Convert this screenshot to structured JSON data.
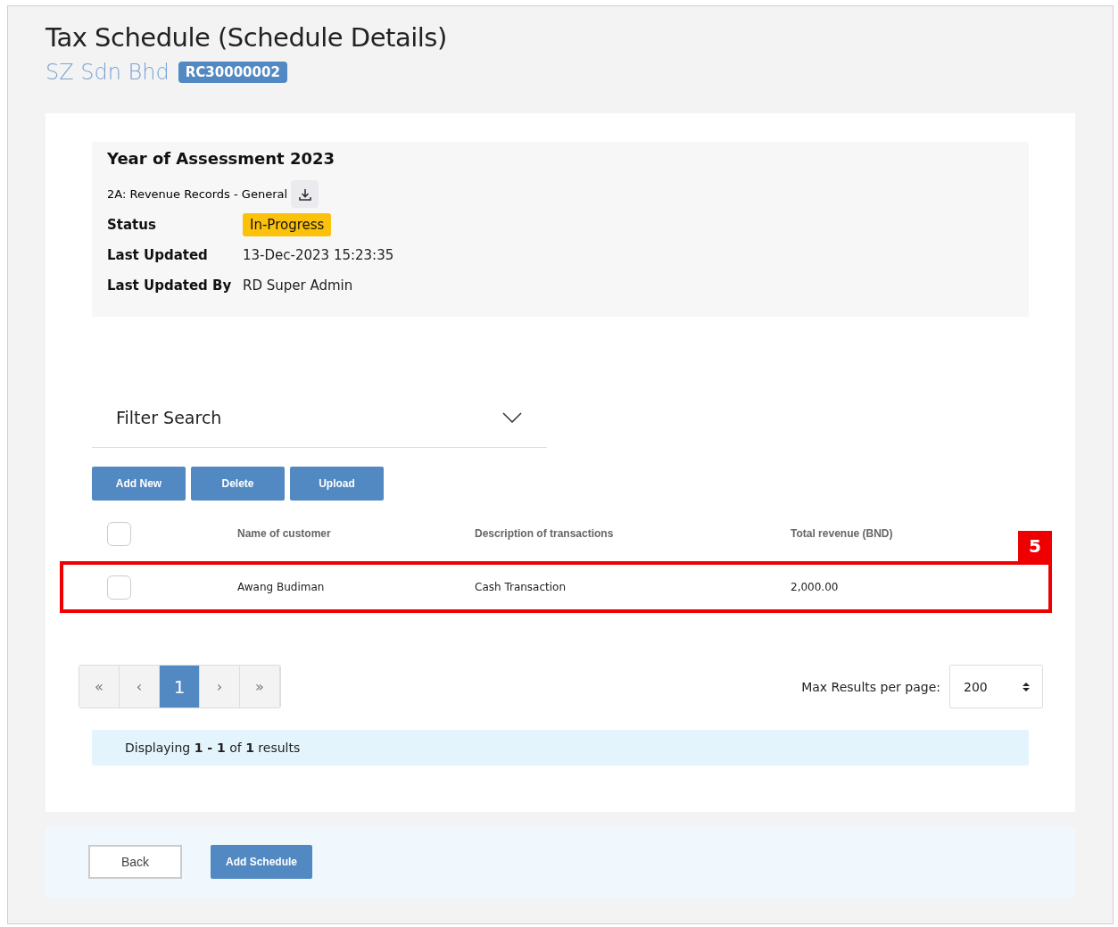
{
  "title": "Tax Schedule (Schedule Details)",
  "company": {
    "name": "SZ Sdn Bhd",
    "code": "RC30000002"
  },
  "assessment": {
    "title": "Year of Assessment 2023",
    "record": "2A: Revenue Records - General",
    "fields": [
      {
        "label": "Status",
        "value": "In-Progress",
        "kind": "badge"
      },
      {
        "label": "Last Updated",
        "value": "13-Dec-2023 15:23:35",
        "kind": "text"
      },
      {
        "label": "Last Updated By",
        "value": "RD Super Admin",
        "kind": "text"
      }
    ]
  },
  "filter": {
    "title": "Filter Search",
    "expanded": false
  },
  "actions": [
    "Add New",
    "Delete",
    "Upload"
  ],
  "table": {
    "header_checked": false,
    "columns": [
      "Name of customer",
      "Description of transactions",
      "Total revenue (BND)"
    ],
    "rows": [
      {
        "checked": false,
        "highlighted": true,
        "callout": "5",
        "cells": [
          "Awang Budiman",
          "Cash Transaction",
          "2,000.00"
        ]
      }
    ]
  },
  "pagination": {
    "items": [
      {
        "label": "«",
        "selected": false
      },
      {
        "label": "‹",
        "selected": false
      },
      {
        "label": "1",
        "selected": true
      },
      {
        "label": "›",
        "selected": false
      },
      {
        "label": "»",
        "selected": false
      }
    ],
    "per_page_label": "Max Results per page:",
    "per_page": "200"
  },
  "summary": "Displaying **1 - 1** of **1** results",
  "footer": {
    "back": "Back",
    "submit": "Add Schedule"
  }
}
